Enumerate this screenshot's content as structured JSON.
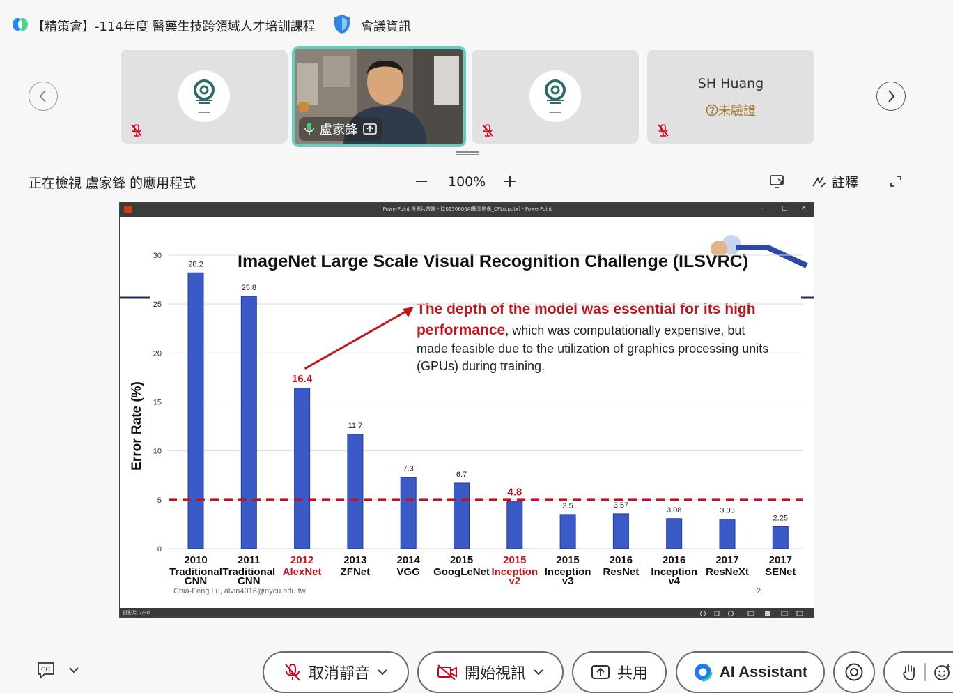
{
  "header": {
    "meeting_title": "【精策會】-114年度 醫藥生技跨領域人才培訓課程",
    "meeting_info_label": "會議資訊"
  },
  "participants": [
    {
      "type": "logo",
      "muted": true
    },
    {
      "type": "video",
      "name": "盧家鋒",
      "active_speaker": true,
      "sharing": true
    },
    {
      "type": "logo",
      "muted": true
    },
    {
      "type": "text",
      "name": "SH Huang",
      "status": "未驗證",
      "muted": true
    }
  ],
  "view_toolbar": {
    "viewing_label": "正在檢視 盧家鋒 的應用程式",
    "zoom_level": "100%",
    "annotate_label": "註釋"
  },
  "ppt_window": {
    "title": "PowerPoint 投影片放映 - [20250606AI醫學影像_CFLu.pptx] - PowerPoint",
    "slide_counter": "投影片 2/30",
    "controls": {
      "minimize": "–",
      "maximize": "□",
      "close": "✕"
    }
  },
  "slide": {
    "title": "ImageNet Large Scale Visual Recognition Challenge (ILSVRC)",
    "highlight_text": "The depth of the model was essential for its high performance",
    "body_line1_tail": ", which was computationally expensive, but",
    "body_line2": "made feasible due to the utilization of graphics processing units",
    "body_line3": "(GPUs) during training.",
    "footer_author": "Chia-Feng Lu, alvin4016@nycu.edu.tw",
    "page_number": "2"
  },
  "chart_data": {
    "type": "bar",
    "ylabel": "Error Rate (%)",
    "ylim": [
      0,
      30
    ],
    "yticks": [
      0,
      5,
      10,
      15,
      20,
      25,
      30
    ],
    "grid": true,
    "reference_line": {
      "y": 5,
      "style": "dashed",
      "color": "#c0161b"
    },
    "bar_color": "#3a5bc7",
    "highlight_color": "#c0161b",
    "categories": [
      {
        "year": "2010",
        "model": "Traditional CNN",
        "value": 28.2,
        "label": "28.2",
        "highlight": false
      },
      {
        "year": "2011",
        "model": "Traditional CNN",
        "value": 25.8,
        "label": "25.8",
        "highlight": false
      },
      {
        "year": "2012",
        "model": "AlexNet",
        "value": 16.4,
        "label": "16.4",
        "highlight": true
      },
      {
        "year": "2013",
        "model": "ZFNet",
        "value": 11.7,
        "label": "11.7",
        "highlight": false
      },
      {
        "year": "2014",
        "model": "VGG",
        "value": 7.3,
        "label": "7.3",
        "highlight": false
      },
      {
        "year": "2015",
        "model": "GoogLeNet",
        "value": 6.7,
        "label": "6.7",
        "highlight": false
      },
      {
        "year": "2015",
        "model": "Inception v2",
        "value": 4.8,
        "label": "4.8",
        "highlight": true
      },
      {
        "year": "2015",
        "model": "Inception v3",
        "value": 3.5,
        "label": "3.5",
        "highlight": false
      },
      {
        "year": "2016",
        "model": "ResNet",
        "value": 3.57,
        "label": "3.57",
        "highlight": false
      },
      {
        "year": "2016",
        "model": "Inception v4",
        "value": 3.08,
        "label": "3.08",
        "highlight": false
      },
      {
        "year": "2017",
        "model": "ResNeXt",
        "value": 3.03,
        "label": "3.03",
        "highlight": false
      },
      {
        "year": "2017",
        "model": "SENet",
        "value": 2.25,
        "label": "2.25",
        "highlight": false
      }
    ]
  },
  "controls": {
    "mute_label": "取消靜音",
    "video_label": "開始視訊",
    "share_label": "共用",
    "ai_label": "AI Assistant"
  },
  "colors": {
    "accent_teal": "#5fd0c2",
    "slide_red": "#c0161b",
    "unverified_gold": "#a4762a"
  }
}
